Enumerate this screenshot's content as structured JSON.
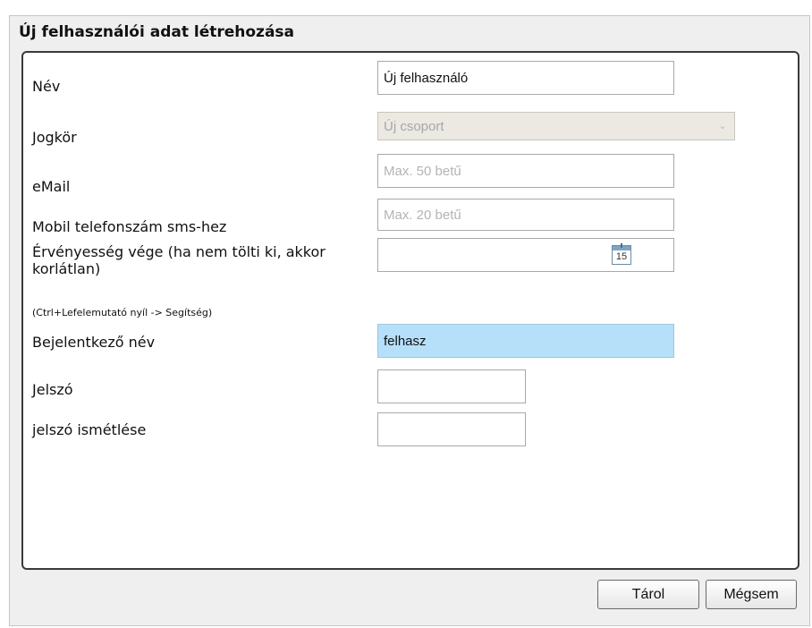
{
  "dialog": {
    "title": "Új felhasználói adat létrehozása"
  },
  "form": {
    "name_label": "Név",
    "name_value": "Új felhasználó",
    "role_label": "Jogkör",
    "role_value": "Új csoport",
    "email_label": "eMail",
    "email_placeholder": "Max. 50 betű",
    "mobile_label": "Mobil telefonszám sms-hez",
    "mobile_placeholder": "Max. 20 betű",
    "expiry_label": "Érvényesség vége (ha nem tölti ki, akkor korlátlan)",
    "expiry_value": "",
    "calendar_day": "15",
    "hint": "(Ctrl+Lefelemutató nyíl -> Segítség)",
    "login_label": "Bejelentkező név",
    "login_value": "felhasz",
    "password_label": "Jelszó",
    "password_repeat_label": "jelszó ismétlése"
  },
  "buttons": {
    "save": "Tárol",
    "cancel": "Mégsem"
  },
  "colors": {
    "highlight": "#b6e0fa",
    "disabled": "#ebe9e2"
  }
}
